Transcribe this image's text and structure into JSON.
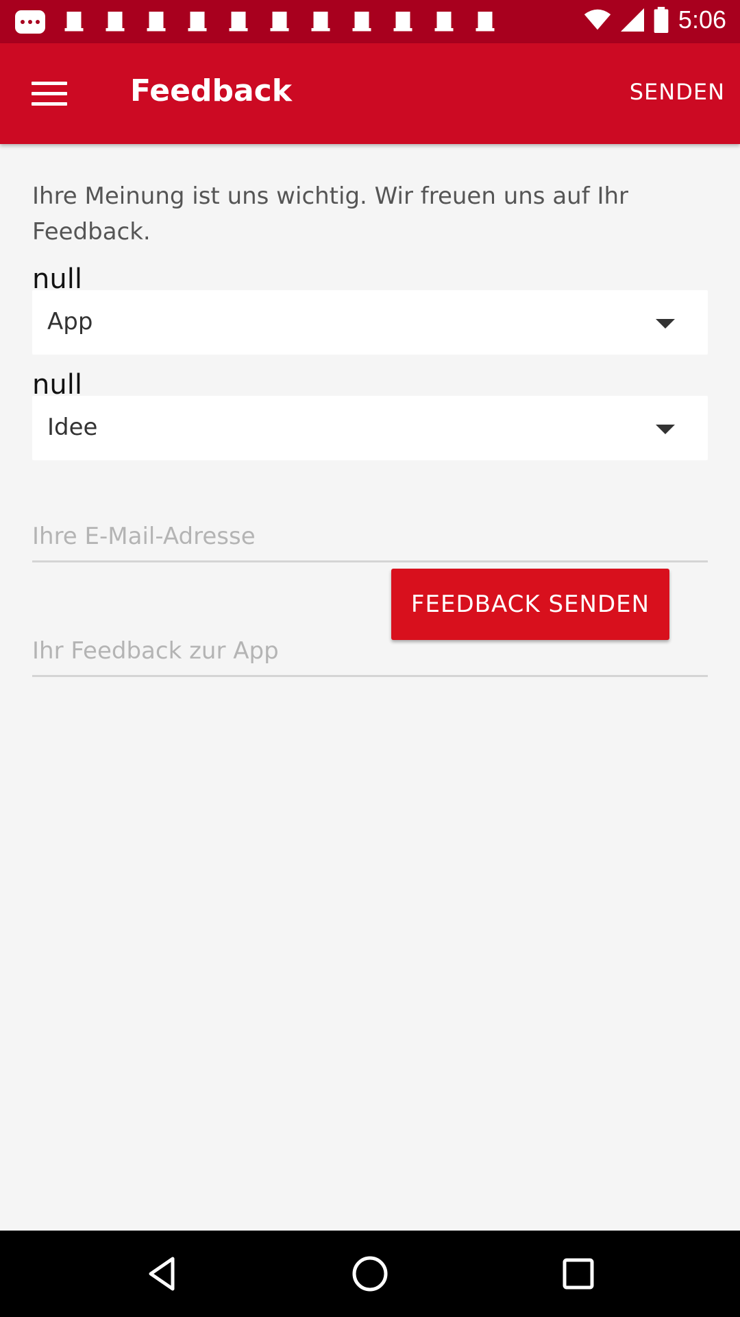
{
  "status_bar": {
    "time": "5:06",
    "icons": [
      "more-dots-icon",
      "notification-icon",
      "wifi-icon",
      "signal-icon",
      "battery-icon"
    ],
    "background": "#a8001e"
  },
  "app_bar": {
    "title": "Feedback",
    "action_label": "SENDEN",
    "background": "#cc0a23",
    "menu_icon": "hamburger-menu-icon"
  },
  "form": {
    "intro": "Ihre Meinung ist uns wichtig. Wir freuen uns auf Ihr Feedback.",
    "category": {
      "label": "null",
      "selected": "App"
    },
    "type": {
      "label": "null",
      "selected": "Idee"
    },
    "email": {
      "value": "",
      "placeholder": "Ihre E-Mail-Adresse"
    },
    "feedback": {
      "value": "",
      "placeholder": "Ihr Feedback zur App"
    },
    "submit_label": "FEEDBACK SENDEN",
    "accent": "#d8101d"
  },
  "nav_bar": {
    "icons": [
      "back-icon",
      "home-icon",
      "recents-icon"
    ]
  }
}
